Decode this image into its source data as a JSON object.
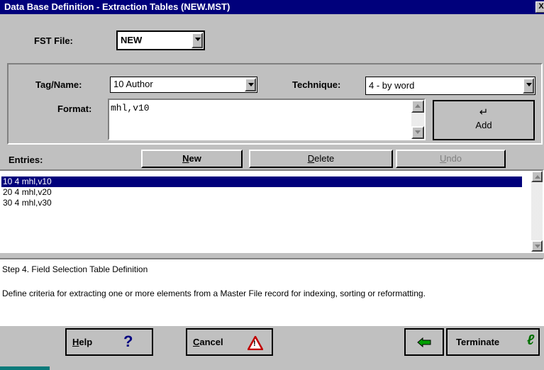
{
  "window": {
    "title": "Data Base Definition - Extraction Tables (NEW.MST)",
    "close_glyph": "X"
  },
  "fst": {
    "label": "FST File:",
    "value": "NEW"
  },
  "tag": {
    "label": "Tag/Name:",
    "value": "10 Author"
  },
  "technique": {
    "label": "Technique:",
    "value": "4 - by word"
  },
  "format": {
    "label": "Format:",
    "value": "mhl,v10"
  },
  "add": {
    "label": "Add",
    "icon_glyph": "↵"
  },
  "entries": {
    "label": "Entries:",
    "new_label_u": "N",
    "new_label_rest": "ew",
    "delete_label_u": "D",
    "delete_label_rest": "elete",
    "undo_label_u": "U",
    "undo_label_rest": "ndo",
    "items": [
      "10 4 mhl,v10",
      "20 4 mhl,v20",
      "30 4 mhl,v30"
    ],
    "selected_index": 0
  },
  "help_text": {
    "title": "Step 4. Field Selection Table Definition",
    "body": "Define criteria for extracting one or more elements from a Master File record for indexing, sorting or reformatting."
  },
  "footer": {
    "help_u": "H",
    "help_rest": "elp",
    "help_glyph": "?",
    "cancel_u": "C",
    "cancel_rest": "ancel",
    "cancel_glyph": "!",
    "back_glyph": "⇦",
    "terminate": "Terminate",
    "terminate_glyph": "ℓ"
  },
  "colors": {
    "titlebar": "#00007b",
    "selection": "#00007b",
    "face": "#c0c0c0"
  }
}
